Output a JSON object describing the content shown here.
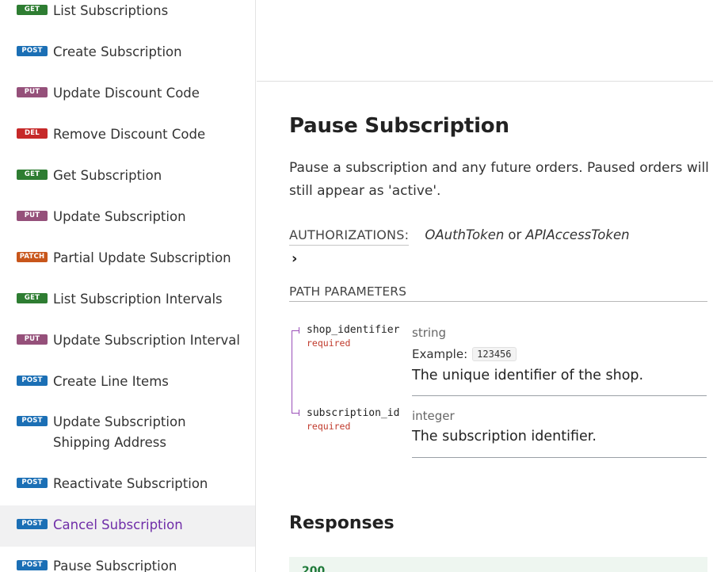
{
  "sidebar": {
    "items": [
      {
        "method": "GET",
        "label": "List Subscriptions"
      },
      {
        "method": "POST",
        "label": "Create Subscription"
      },
      {
        "method": "PUT",
        "label": "Update Discount Code"
      },
      {
        "method": "DEL",
        "label": "Remove Discount Code"
      },
      {
        "method": "GET",
        "label": "Get Subscription"
      },
      {
        "method": "PUT",
        "label": "Update Subscription"
      },
      {
        "method": "PATCH",
        "label": "Partial Update Subscription"
      },
      {
        "method": "GET",
        "label": "List Subscription Intervals"
      },
      {
        "method": "PUT",
        "label": "Update Subscription Interval"
      },
      {
        "method": "POST",
        "label": "Create Line Items"
      },
      {
        "method": "POST",
        "label": "Update Subscription Shipping Address"
      },
      {
        "method": "POST",
        "label": "Reactivate Subscription"
      },
      {
        "method": "POST",
        "label": "Cancel Subscription",
        "active": true
      },
      {
        "method": "POST",
        "label": "Pause Subscription"
      }
    ]
  },
  "colors": {
    "GET": "#2e7d32",
    "POST": "#1b6fb5",
    "PUT": "#95507a",
    "DEL": "#c62828",
    "PATCH": "#c8561b",
    "accent": "#6f2da8"
  },
  "main": {
    "title": "Pause Subscription",
    "description": "Pause a subscription and any future orders. Paused orders will still appear as 'active'.",
    "auth": {
      "label": "AUTHORIZATIONS:",
      "token1": "OAuthToken",
      "or": "or",
      "token2": "APIAccessToken",
      "expand_icon": "chevron-right-icon"
    },
    "path_params": {
      "title": "PATH PARAMETERS",
      "params": [
        {
          "name": "shop_identifier",
          "required": "required",
          "type": "string",
          "example_label": "Example:",
          "example_value": "123456",
          "description": "The unique identifier of the shop."
        },
        {
          "name": "subscription_id",
          "required": "required",
          "type": "integer",
          "description": "The subscription identifier."
        }
      ]
    },
    "responses": {
      "title": "Responses",
      "first_code": "200"
    }
  }
}
